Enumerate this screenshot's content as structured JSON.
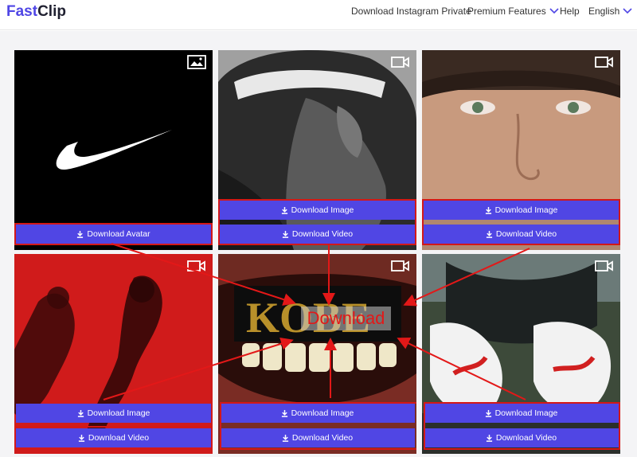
{
  "header": {
    "logo_part1": "Fast",
    "logo_part2": "Clip",
    "nav_private": "Download Instagram Private",
    "nav_premium": "Premium Features",
    "nav_help": "Help",
    "nav_language": "English"
  },
  "cards": [
    {
      "type": "image-icon",
      "buttons": [
        "Download Avatar"
      ]
    },
    {
      "type": "video-icon",
      "buttons": [
        "Download Image",
        "Download Video"
      ]
    },
    {
      "type": "video-icon",
      "buttons": [
        "Download Image",
        "Download Video"
      ]
    },
    {
      "type": "video-icon",
      "buttons": [
        "Download Image",
        "Download Video"
      ]
    },
    {
      "type": "video-icon",
      "buttons": [
        "Download Image",
        "Download Video"
      ],
      "overlay_text": "KOBE"
    },
    {
      "type": "video-icon",
      "buttons": [
        "Download Image",
        "Download Video"
      ]
    }
  ],
  "annotation": {
    "label": "Download",
    "color": "#e31818"
  },
  "colors": {
    "accent": "#5046e4",
    "highlight": "#d31818"
  }
}
